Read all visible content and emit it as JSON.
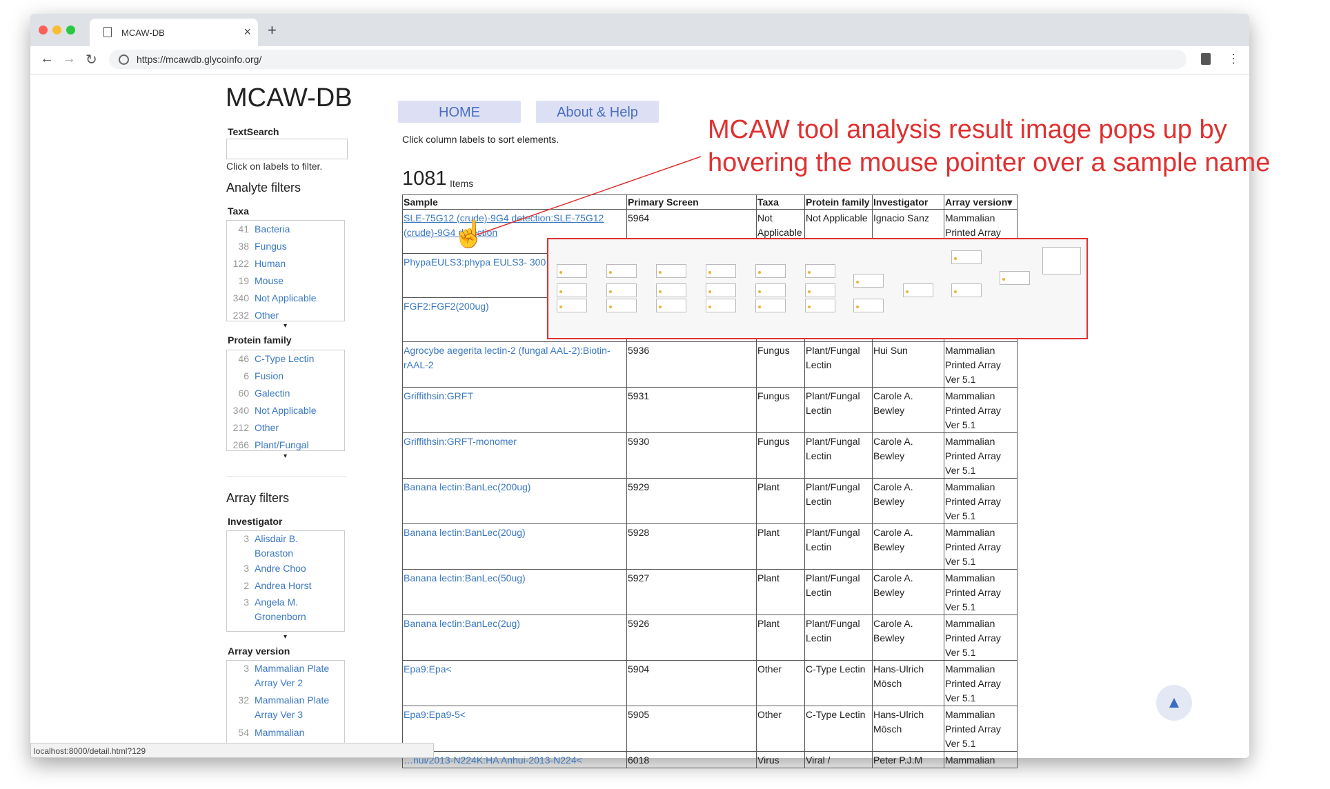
{
  "browser": {
    "tab_title": "MCAW-DB",
    "tab_close": "×",
    "new_tab": "+",
    "url": "https://mcawdb.glycoinfo.org/",
    "status_url": "localhost:8000/detail.html?129"
  },
  "site": {
    "title": "MCAW-DB",
    "textsearch_label": "TextSearch",
    "filter_hint": "Click on labels to filter.",
    "analyte_filters": "Analyte filters",
    "array_filters": "Array filters",
    "nav": {
      "home": "HOME",
      "about": "About & Help"
    },
    "sort_hint": "Click column labels to sort elements.",
    "item_count": "1081",
    "items_word": "Items"
  },
  "filters": {
    "taxa": {
      "label": "Taxa",
      "items": [
        {
          "count": "41",
          "name": "Bacteria"
        },
        {
          "count": "38",
          "name": "Fungus"
        },
        {
          "count": "122",
          "name": "Human"
        },
        {
          "count": "19",
          "name": "Mouse"
        },
        {
          "count": "340",
          "name": "Not Applicable"
        },
        {
          "count": "232",
          "name": "Other"
        }
      ]
    },
    "protein_family": {
      "label": "Protein family",
      "items": [
        {
          "count": "46",
          "name": "C-Type Lectin"
        },
        {
          "count": "6",
          "name": "Fusion"
        },
        {
          "count": "60",
          "name": "Galectin"
        },
        {
          "count": "340",
          "name": "Not Applicable"
        },
        {
          "count": "212",
          "name": "Other"
        },
        {
          "count": "266",
          "name": "Plant/Fungal"
        }
      ]
    },
    "investigator": {
      "label": "Investigator",
      "items": [
        {
          "count": "3",
          "name": "Alisdair B. Boraston"
        },
        {
          "count": "3",
          "name": "Andre Choo"
        },
        {
          "count": "2",
          "name": "Andrea Horst"
        },
        {
          "count": "3",
          "name": "Angela M. Gronenborn"
        }
      ]
    },
    "array_version": {
      "label": "Array version",
      "items": [
        {
          "count": "3",
          "name": "Mammalian Plate Array Ver 2"
        },
        {
          "count": "32",
          "name": "Mammalian Plate Array Ver 3"
        },
        {
          "count": "54",
          "name": "Mammalian"
        }
      ]
    }
  },
  "table": {
    "headers": [
      "Sample",
      "Primary Screen",
      "Taxa",
      "Protein family",
      "Investigator",
      "Array version▾"
    ],
    "rows": [
      [
        "SLE-75G12 (crude)-9G4 detection:SLE-75G12 (crude)-9G4 detection",
        "5964",
        "Not Applicable",
        "Not Applicable",
        "Ignacio Sanz",
        "Mammalian Printed Array"
      ],
      [
        "PhypaEULS3:phypa EULS3- 300",
        "",
        "",
        "",
        "",
        ""
      ],
      [
        "FGF2:FGF2(200ug)",
        "",
        "",
        "",
        "",
        ""
      ],
      [
        "Agrocybe aegerita lectin-2 (fungal AAL-2):Biotin-rAAL-2",
        "5936",
        "Fungus",
        "Plant/Fungal Lectin",
        "Hui Sun",
        "Mammalian Printed Array Ver 5.1"
      ],
      [
        "Griffithsin:GRFT",
        "5931",
        "Fungus",
        "Plant/Fungal Lectin",
        "Carole A. Bewley",
        "Mammalian Printed Array Ver 5.1"
      ],
      [
        "Griffithsin:GRFT-monomer",
        "5930",
        "Fungus",
        "Plant/Fungal Lectin",
        "Carole A. Bewley",
        "Mammalian Printed Array Ver 5.1"
      ],
      [
        "Banana lectin:BanLec(200ug)",
        "5929",
        "Plant",
        "Plant/Fungal Lectin",
        "Carole A. Bewley",
        "Mammalian Printed Array Ver 5.1"
      ],
      [
        "Banana lectin:BanLec(20ug)",
        "5928",
        "Plant",
        "Plant/Fungal Lectin",
        "Carole A. Bewley",
        "Mammalian Printed Array Ver 5.1"
      ],
      [
        "Banana lectin:BanLec(50ug)",
        "5927",
        "Plant",
        "Plant/Fungal Lectin",
        "Carole A. Bewley",
        "Mammalian Printed Array Ver 5.1"
      ],
      [
        "Banana lectin:BanLec(2ug)",
        "5926",
        "Plant",
        "Plant/Fungal Lectin",
        "Carole A. Bewley",
        "Mammalian Printed Array Ver 5.1"
      ],
      [
        "Epa9:Epa<",
        "5904",
        "Other",
        "C-Type Lectin",
        "Hans-Ulrich Mösch",
        "Mammalian Printed Array Ver 5.1"
      ],
      [
        "Epa9:Epa9-5<",
        "5905",
        "Other",
        "C-Type Lectin",
        "Hans-Ulrich Mösch",
        "Mammalian Printed Array Ver 5.1"
      ],
      [
        "…nui/2013-N224K:HA Anhui-2013-N224<",
        "6018",
        "Virus",
        "Viral /",
        "Peter P.J.M",
        "Mammalian"
      ]
    ]
  },
  "annotation": {
    "line1": "MCAW tool analysis result image pops up by",
    "line2": "hovering the mouse pointer over a sample name"
  },
  "icons": {
    "caret": "▾",
    "scroll_top": "▲",
    "back": "←",
    "forward": "→",
    "reload": "↻",
    "menu": "⋮",
    "cursor": "☝"
  },
  "colors": {
    "link": "#3a78c2",
    "annotation": "#e03030",
    "nav_button_bg": "#dde0f5"
  }
}
